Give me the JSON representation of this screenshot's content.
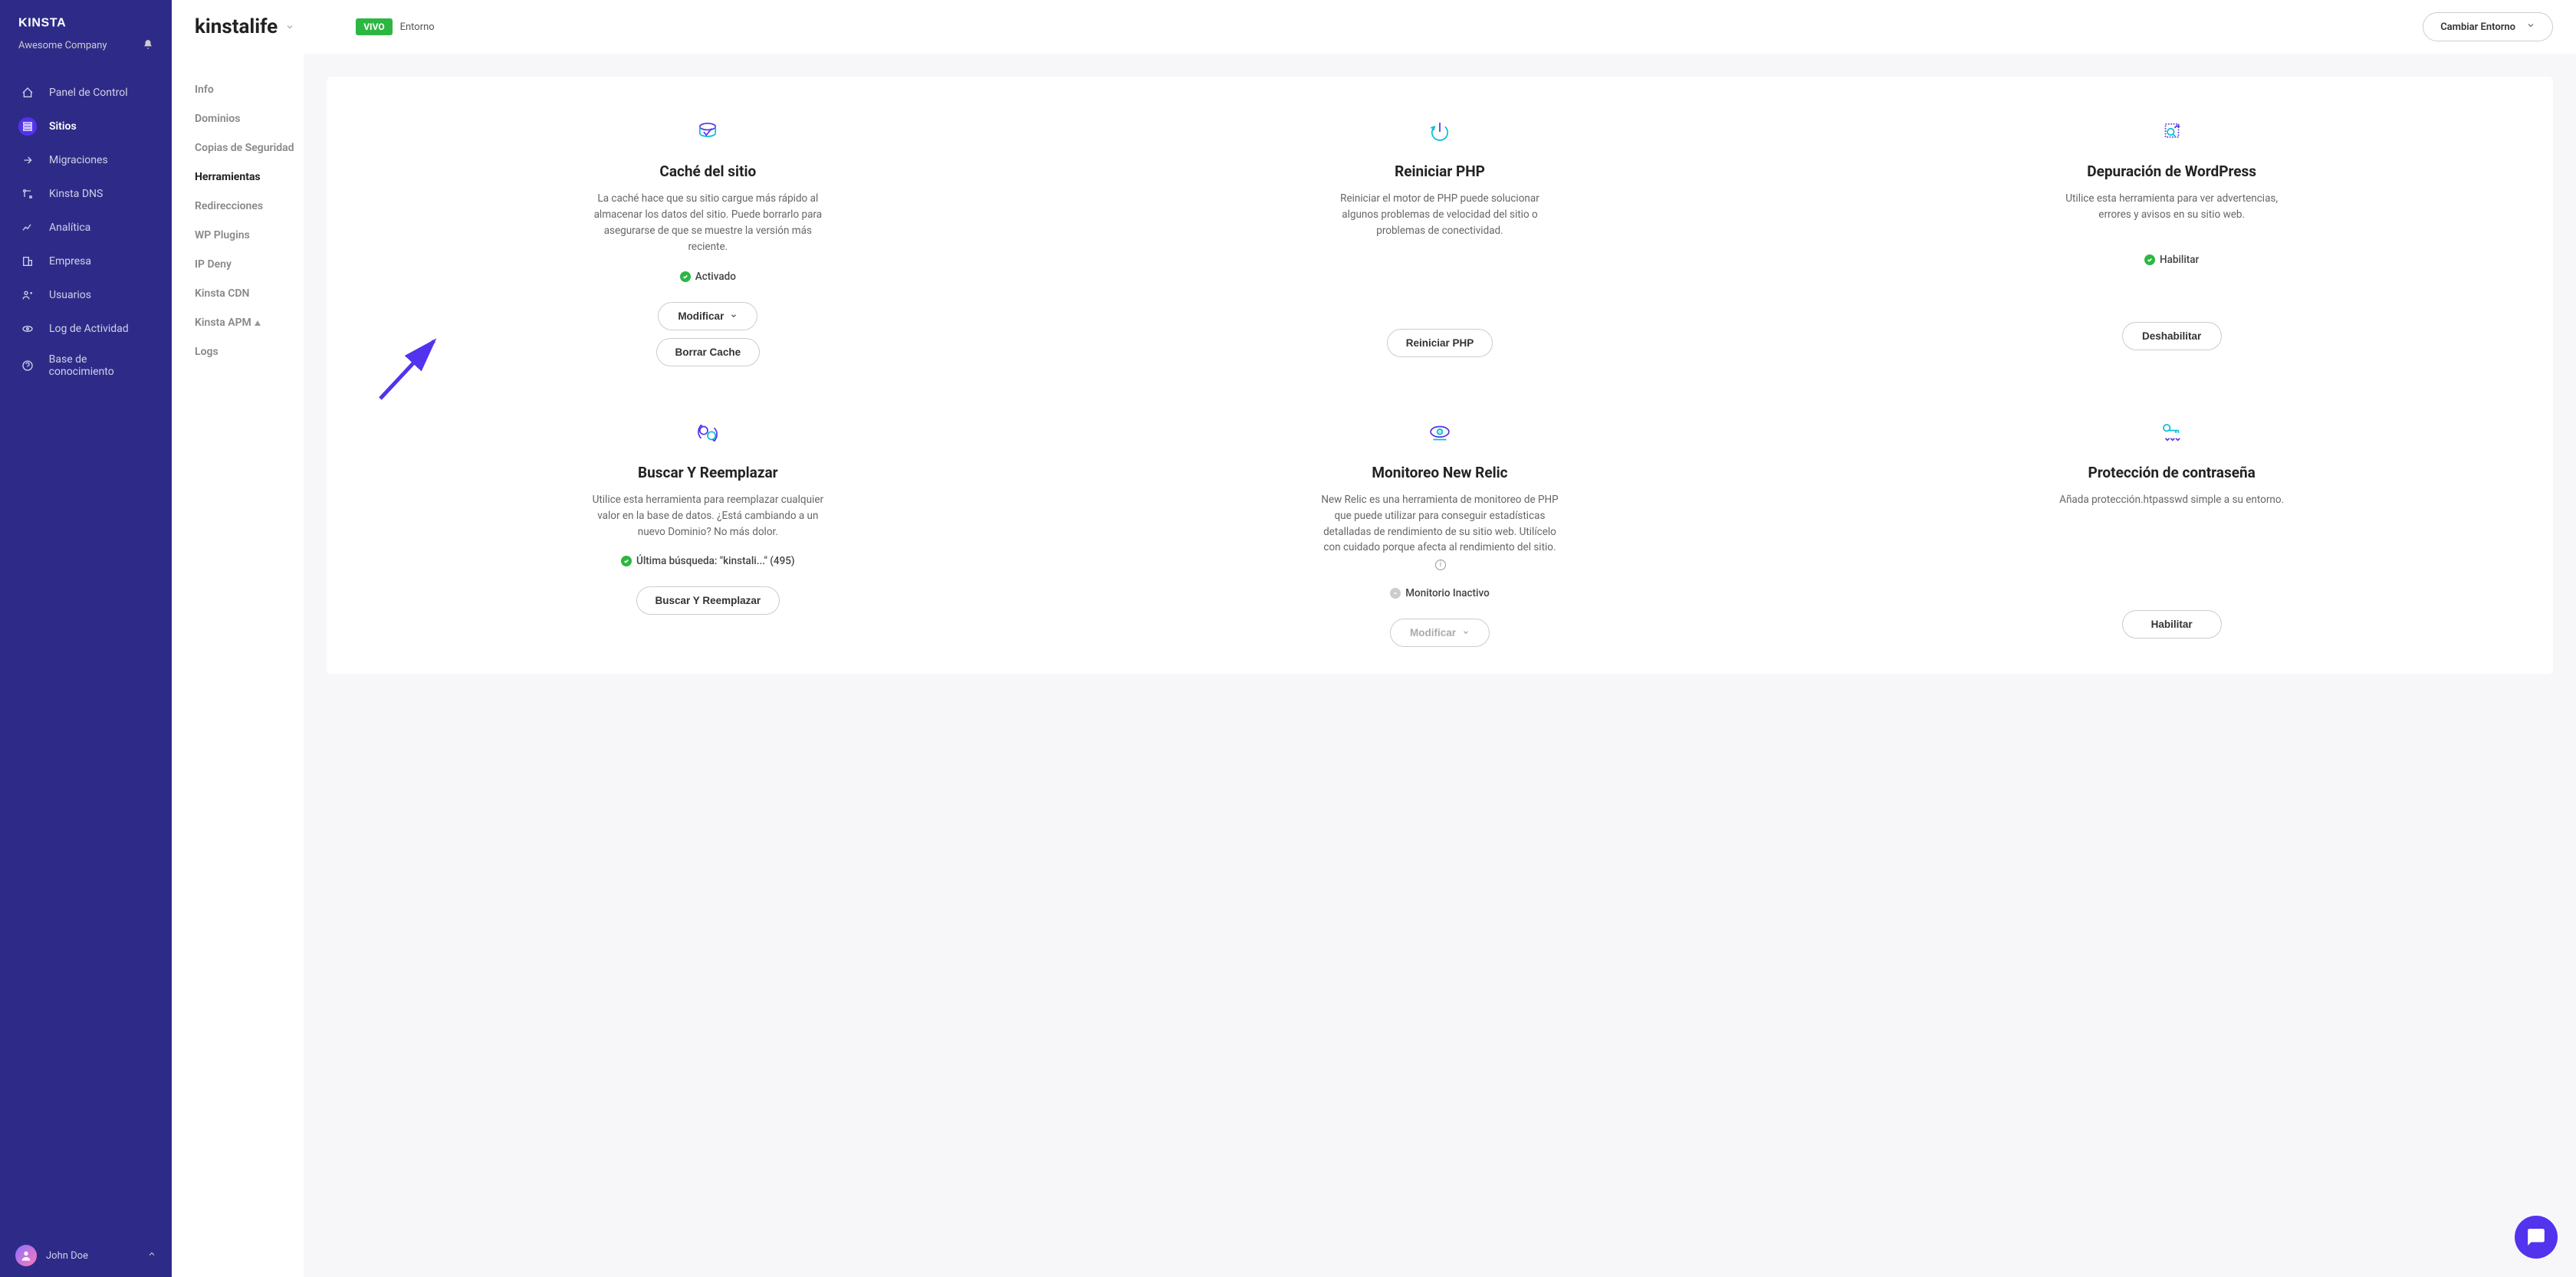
{
  "brand": "kinsta",
  "company": "Awesome Company",
  "header": {
    "site_name": "kinstalife",
    "env_badge": "VIVO",
    "env_label": "Entorno",
    "switch_label": "Cambiar Entorno"
  },
  "nav_main": [
    {
      "label": "Panel de Control"
    },
    {
      "label": "Sitios"
    },
    {
      "label": "Migraciones"
    },
    {
      "label": "Kinsta DNS"
    },
    {
      "label": "Analítica"
    },
    {
      "label": "Empresa"
    },
    {
      "label": "Usuarios"
    },
    {
      "label": "Log de Actividad"
    },
    {
      "label": "Base de conocimiento"
    }
  ],
  "nav_second": [
    {
      "label": "Info"
    },
    {
      "label": "Dominios"
    },
    {
      "label": "Copias de Seguridad"
    },
    {
      "label": "Herramientas"
    },
    {
      "label": "Redirecciones"
    },
    {
      "label": "WP Plugins"
    },
    {
      "label": "IP Deny"
    },
    {
      "label": "Kinsta CDN"
    },
    {
      "label": "Kinsta APM"
    },
    {
      "label": "Logs"
    }
  ],
  "tools": {
    "cache": {
      "title": "Caché del sitio",
      "desc": "La caché hace que su sitio cargue más rápido al almacenar los datos del sitio. Puede borrarlo para asegurarse de que se muestre la versión más reciente.",
      "status": "Activado",
      "btn1": "Modificar",
      "btn2": "Borrar Cache"
    },
    "php": {
      "title": "Reiniciar PHP",
      "desc": "Reiniciar el motor de PHP puede solucionar algunos problemas de velocidad del sitio o problemas de conectividad.",
      "btn": "Reiniciar PHP"
    },
    "debug": {
      "title": "Depuración de WordPress",
      "desc": "Utilice esta herramienta para ver advertencias, errores y avisos en su sitio web.",
      "status": "Habilitar",
      "btn": "Deshabilitar"
    },
    "search": {
      "title": "Buscar Y Reemplazar",
      "desc": "Utilice esta herramienta para reemplazar cualquier valor en la base de datos. ¿Está cambiando a un nuevo Dominio? No más dolor.",
      "status": "Última búsqueda: \"kinstali...\" (495)",
      "btn": "Buscar Y Reemplazar"
    },
    "newrelic": {
      "title": "Monitoreo New Relic",
      "desc": "New Relic es una herramienta de monitoreo de PHP que puede utilizar para conseguir estadísticas detalladas de rendimiento de su sitio web. Utilícelo con cuidado porque afecta al rendimiento del sitio.",
      "status": "Monitorio Inactivo",
      "btn": "Modificar"
    },
    "password": {
      "title": "Protección de contraseña",
      "desc": "Añada protección.htpasswd simple a su entorno.",
      "btn": "Habilitar"
    }
  },
  "user": {
    "name": "John Doe"
  }
}
